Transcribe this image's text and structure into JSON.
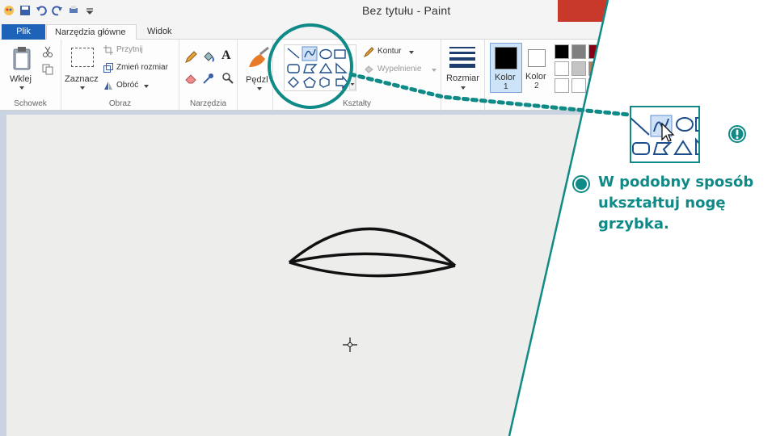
{
  "window": {
    "title": "Bez tytułu - Paint"
  },
  "tabs": [
    {
      "label": "Plik"
    },
    {
      "label": "Narzędzia główne"
    },
    {
      "label": "Widok"
    }
  ],
  "ribbon": {
    "clipboard": {
      "paste_label": "Wklej",
      "group_label": "Schowek"
    },
    "image": {
      "select_label": "Zaznacz",
      "crop_label": "Przytnij",
      "resize_label": "Zmień rozmiar",
      "rotate_label": "Obróć",
      "group_label": "Obraz"
    },
    "tools": {
      "group_label": "Narzędzia"
    },
    "brushes": {
      "label": "Pędzl"
    },
    "shapes": {
      "outline_label": "Kontur",
      "fill_label": "Wypełnienie",
      "group_label": "Kształty"
    },
    "size": {
      "label": "Rozmiar"
    },
    "colors": {
      "color1_label": "Kolor",
      "color1_num": "1",
      "color2_label": "Kolor",
      "color2_num": "2",
      "palette": [
        "#000000",
        "#7f7f7f",
        "#880015",
        "#ffffff",
        "#c3c3c3",
        "#b97a57",
        "#ffffff",
        "#ffffff",
        "#ffffff"
      ]
    }
  },
  "instruction": {
    "text": "W podobny sposób ukształtuj nogę grzybka."
  },
  "accent_color": "#0f8a87",
  "icons": [
    "warning-icon",
    "bullet-icon",
    "crosshair-cursor-icon",
    "curve-tool-icon"
  ]
}
